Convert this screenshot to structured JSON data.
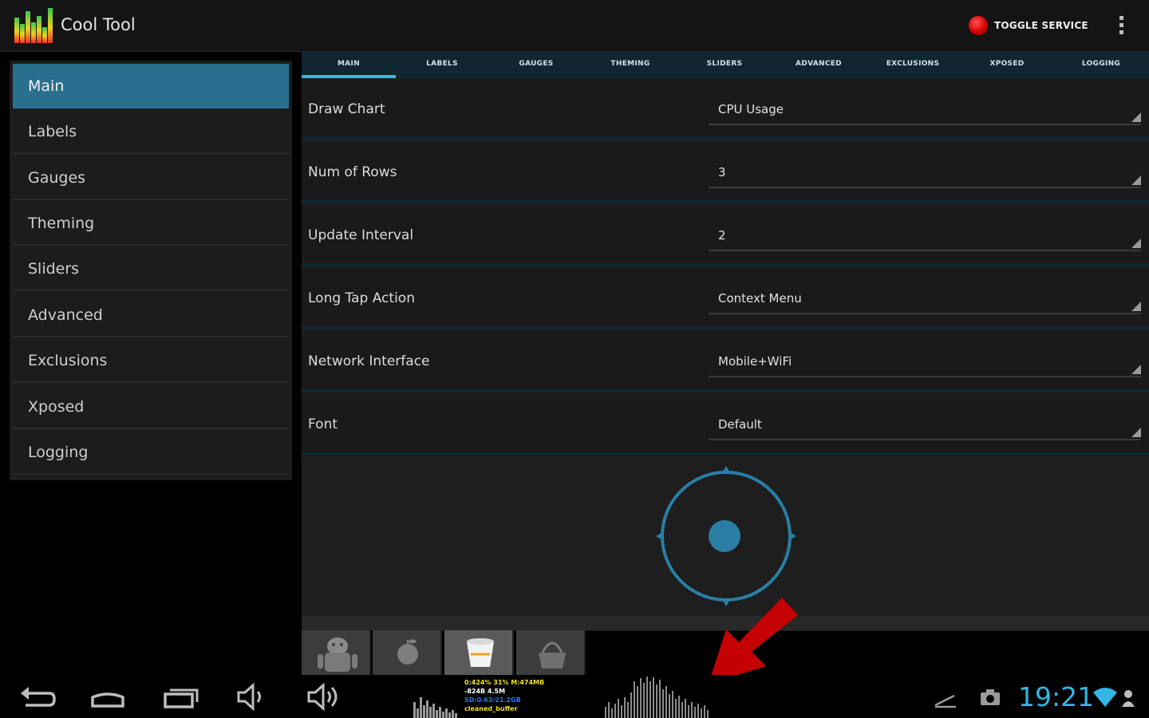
{
  "app": {
    "title": "Cool Tool"
  },
  "actions": {
    "toggle_service": "TOGGLE SERVICE"
  },
  "sidebar": {
    "items": [
      {
        "label": "Main",
        "active": true
      },
      {
        "label": "Labels"
      },
      {
        "label": "Gauges"
      },
      {
        "label": "Theming"
      },
      {
        "label": "Sliders"
      },
      {
        "label": "Advanced"
      },
      {
        "label": "Exclusions"
      },
      {
        "label": "Xposed"
      },
      {
        "label": "Logging"
      }
    ]
  },
  "tabs": [
    "MAIN",
    "LABELS",
    "GAUGES",
    "THEMING",
    "SLIDERS",
    "ADVANCED",
    "EXCLUSIONS",
    "XPOSED",
    "LOGGING"
  ],
  "settings": [
    {
      "label": "Draw Chart",
      "value": "CPU Usage"
    },
    {
      "label": "Num of Rows",
      "value": "3"
    },
    {
      "label": "Update Interval",
      "value": "2"
    },
    {
      "label": "Long Tap Action",
      "value": "Context Menu"
    },
    {
      "label": "Network Interface",
      "value": "Mobile+WiFi"
    },
    {
      "label": "Font",
      "value": "Default"
    }
  ],
  "dock_icons": [
    "android-icon",
    "apple-icon",
    "bucket-icon",
    "basket-icon"
  ],
  "status": {
    "clock": "19:21",
    "cpu_lines": [
      {
        "text": "0:424% 31% M:474MB",
        "color": "#f0e020"
      },
      {
        "text": "-824B 4.5M",
        "color": "#ffffff"
      },
      {
        "text": "SD:0.63/21.2GB",
        "color": "#3070ff"
      },
      {
        "text": "cleaned_buffer",
        "color": "#f0e020"
      }
    ]
  },
  "colors": {
    "accent": "#33b5e5",
    "selection": "#29708f",
    "record": "#d40000",
    "arrow": "#c40000"
  }
}
